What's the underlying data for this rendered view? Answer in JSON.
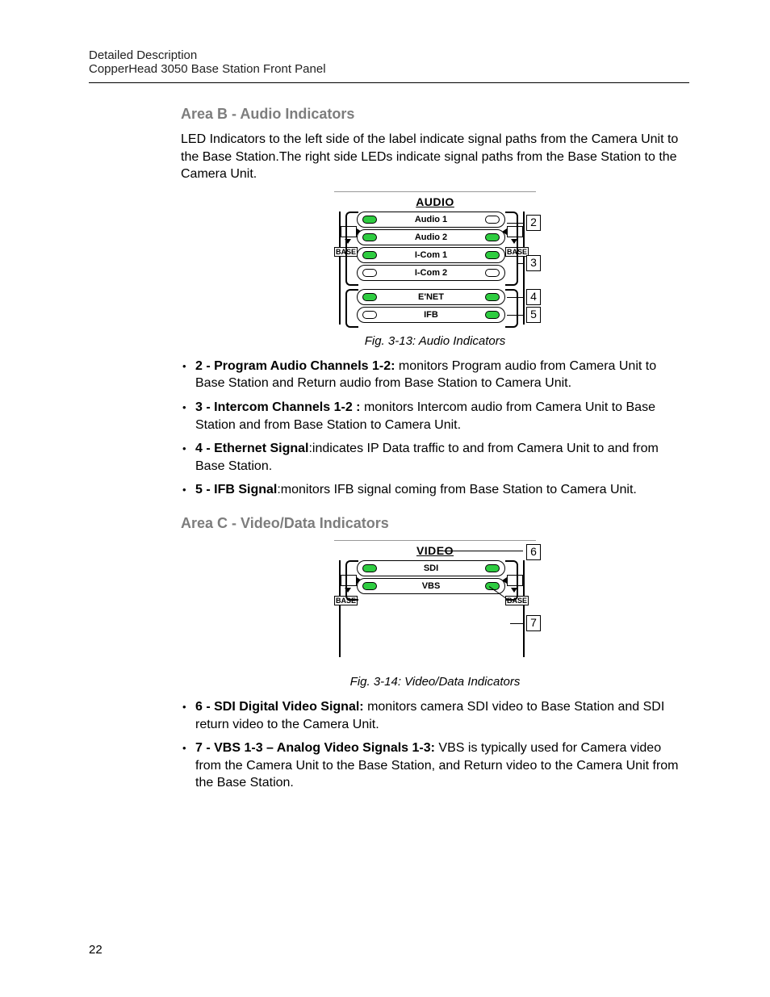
{
  "header": {
    "line1": "Detailed Description",
    "line2": "CopperHead 3050 Base Station Front Panel"
  },
  "pageNumber": "22",
  "sectionB": {
    "heading": "Area B - Audio Indicators",
    "intro": "LED Indicators to the left side of the label indicate signal paths from the Camera Unit to the Base Station.The  right side LEDs indicate signal paths from the Base Station to the Camera Unit.",
    "figure": {
      "title": "AUDIO",
      "rows": [
        {
          "label": "Audio 1",
          "leftOn": true,
          "rightOn": false
        },
        {
          "label": "Audio 2",
          "leftOn": true,
          "rightOn": true
        },
        {
          "label": "I-Com 1",
          "leftOn": true,
          "rightOn": true
        },
        {
          "label": "I-Com 2",
          "leftOn": false,
          "rightOn": false
        },
        {
          "label": "E'NET",
          "leftOn": true,
          "rightOn": true
        },
        {
          "label": "IFB",
          "leftOn": false,
          "rightOn": true
        }
      ],
      "sideLabel": "BASE",
      "callouts": [
        "2",
        "3",
        "4",
        "5"
      ],
      "caption": "Fig. 3-13: Audio Indicators"
    },
    "bullets": [
      {
        "bold": "2 - Program Audio Channels 1-2: ",
        "text": "monitors Program audio from Camera Unit to Base Station and Return audio from Base Station to Camera Unit."
      },
      {
        "bold": "3 - Intercom Channels  1-2 : ",
        "text": "monitors Intercom audio from Camera Unit to Base Station and from Base Station to Camera Unit."
      },
      {
        "bold": "4 - Ethernet Signal",
        "text": ":indicates IP Data traffic to and from Camera Unit to and from Base Station."
      },
      {
        "bold": "5 - IFB Signal",
        "text": ":monitors IFB signal coming from Base Station to Camera Unit."
      }
    ]
  },
  "sectionC": {
    "heading": "Area C - Video/Data Indicators",
    "figure": {
      "title": "VIDEO",
      "rows": [
        {
          "label": "SDI",
          "leftOn": true,
          "rightOn": true
        },
        {
          "label": "VBS",
          "leftOn": true,
          "rightOn": true
        }
      ],
      "sideLabel": "BASE",
      "callouts": [
        "6",
        "7"
      ],
      "caption": "Fig. 3-14: Video/Data Indicators"
    },
    "bullets": [
      {
        "bold": "6 - SDI Digital Video Signal: ",
        "text": "monitors camera SDI video to Base Station and SDI return video to the Camera Unit."
      },
      {
        "bold": "7 - VBS 1-3 – Analog Video Signals 1-3: ",
        "text": "VBS is typically used for Camera video from the Camera Unit to the Base Station, and Return video to the Camera Unit from the Base Station."
      }
    ]
  }
}
